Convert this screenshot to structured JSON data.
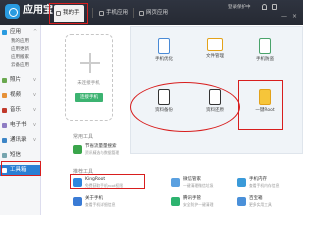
{
  "app": {
    "title": "应用宝"
  },
  "tabs": [
    {
      "label": "我的手机"
    },
    {
      "label": "手机应用"
    },
    {
      "label": "网页应用"
    }
  ],
  "titlebar": {
    "user_text": "登录保护中",
    "minimize": "—",
    "close": "×"
  },
  "sidebar": {
    "items": [
      {
        "label": "应用"
      },
      {
        "label": "照片"
      },
      {
        "label": "视频"
      },
      {
        "label": "音乐"
      },
      {
        "label": "电子书"
      },
      {
        "label": "通讯录"
      },
      {
        "label": "短信"
      },
      {
        "label": "工具箱"
      }
    ],
    "subitems": [
      {
        "label": "我的应用"
      },
      {
        "label": "应用更新"
      },
      {
        "label": "应用搬家"
      },
      {
        "label": "云备应用"
      }
    ]
  },
  "phone_card": {
    "status": "未连接手机",
    "connect_button": "连接手机"
  },
  "tools": [
    {
      "label": "手机优化"
    },
    {
      "label": "文件管理"
    },
    {
      "label": "手机防盗"
    },
    {
      "label": "资料备份"
    },
    {
      "label": "资料还原"
    },
    {
      "label": "一键Root"
    }
  ],
  "common_tools": {
    "title": "常用工具",
    "items": [
      {
        "title": "节省流量量搜索",
        "desc": "资讯精选与数据管理"
      }
    ]
  },
  "recommended_tools": {
    "title": "推荐工具",
    "items": [
      {
        "title": "KingRoot",
        "desc": "免费获取手机root权限"
      },
      {
        "title": "微信管家",
        "desc": "一键清理微信垃圾"
      },
      {
        "title": "手机内存",
        "desc": "查看手机内存信息"
      },
      {
        "title": "关于手机",
        "desc": "查看手机详细信息"
      },
      {
        "title": "腾讯手管",
        "desc": "安全防护一键清理"
      },
      {
        "title": "百宝箱",
        "desc": "更多实用工具"
      }
    ]
  },
  "colors": {
    "titlebar": "#2b2f39",
    "accent": "#2a7fd4",
    "connect": "#3cb371",
    "annotation": "#d81e1e"
  }
}
